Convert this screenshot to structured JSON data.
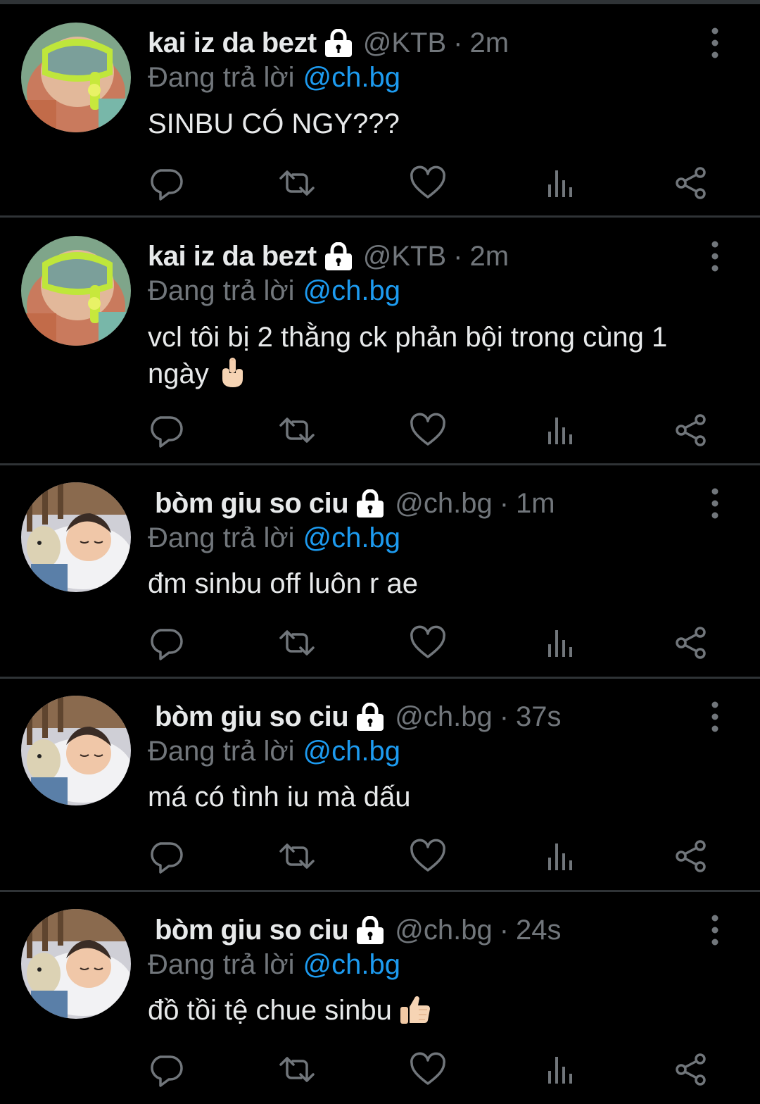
{
  "colors": {
    "background": "#000000",
    "text": "#e7e9ea",
    "secondary": "#71767b",
    "mention": "#1d9bf0",
    "divider": "#2f3336"
  },
  "icons": {
    "lock": "lock-icon",
    "more": "more-vertical-icon",
    "reply": "reply-bubble-icon",
    "retweet": "retweet-icon",
    "like": "heart-icon",
    "views": "views-bar-chart-icon",
    "share": "share-icon"
  },
  "tweets": [
    {
      "display_name": "kai iz da bezt",
      "handle": "@KTB",
      "separator": "·",
      "time": "2m",
      "reply_prefix": "Đang trả lời",
      "reply_to": "@ch.bg",
      "text": "SINBU CÓ NGY???",
      "emoji": "",
      "avatar": "snorkel-mask-avatar"
    },
    {
      "display_name": "kai iz da bezt",
      "handle": "@KTB",
      "separator": "·",
      "time": "2m",
      "reply_prefix": "Đang trả lời",
      "reply_to": "@ch.bg",
      "text": "vcl tôi bị 2 thằng ck phản bội trong cùng 1 ngày",
      "emoji": "middle-finger",
      "avatar": "snorkel-mask-avatar"
    },
    {
      "display_name": " bòm giu so ciu",
      "handle": "@ch.bg",
      "separator": "·",
      "time": "1m",
      "reply_prefix": "Đang trả lời",
      "reply_to": "@ch.bg",
      "text": "đm sinbu off luôn r ae",
      "emoji": "",
      "avatar": "sleeping-baby-avatar"
    },
    {
      "display_name": " bòm giu so ciu",
      "handle": "@ch.bg",
      "separator": "·",
      "time": "37s",
      "reply_prefix": "Đang trả lời",
      "reply_to": "@ch.bg",
      "text": "má có tình iu mà dấu",
      "emoji": "",
      "avatar": "sleeping-baby-avatar"
    },
    {
      "display_name": " bòm giu so ciu",
      "handle": "@ch.bg",
      "separator": "·",
      "time": "24s",
      "reply_prefix": "Đang trả lời",
      "reply_to": "@ch.bg",
      "text": "đồ tồi tệ chue sinbu",
      "emoji": "thumbs-up",
      "avatar": "sleeping-baby-avatar"
    }
  ]
}
